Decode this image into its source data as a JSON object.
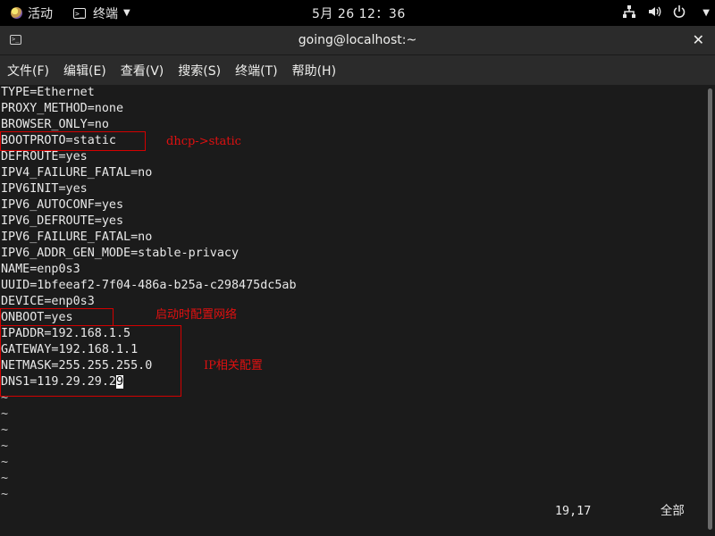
{
  "topbar": {
    "activities": "活动",
    "app_name": "终端",
    "clock": "5月 26  12：36",
    "tray_icons": [
      "network-icon",
      "volume-icon",
      "power-icon"
    ]
  },
  "window": {
    "title": "going@localhost:~",
    "menu": [
      "文件(F)",
      "编辑(E)",
      "查看(V)",
      "搜索(S)",
      "终端(T)",
      "帮助(H)"
    ]
  },
  "editor": {
    "lines": [
      "TYPE=Ethernet",
      "PROXY_METHOD=none",
      "BROWSER_ONLY=no",
      "BOOTPROTO=static",
      "DEFROUTE=yes",
      "IPV4_FAILURE_FATAL=no",
      "IPV6INIT=yes",
      "IPV6_AUTOCONF=yes",
      "IPV6_DEFROUTE=yes",
      "IPV6_FAILURE_FATAL=no",
      "IPV6_ADDR_GEN_MODE=stable-privacy",
      "NAME=enp0s3",
      "UUID=1bfeeaf2-7f04-486a-b25a-c298475dc5ab",
      "DEVICE=enp0s3",
      "ONBOOT=yes",
      "IPADDR=192.168.1.5",
      "GATEWAY=192.168.1.1",
      "NETMASK=255.255.255.0",
      "DNS1=119.29.29.2"
    ],
    "cursor_char": "9",
    "tilde_lines": [
      "~",
      "~",
      "~",
      "~",
      "~",
      "~",
      "~"
    ],
    "position": "19,17",
    "mode": "全部"
  },
  "annotations": {
    "bootproto_note": "dhcp->static",
    "onboot_note": "启动时配置网络",
    "ip_note": "IP相关配置"
  },
  "colors": {
    "annotation": "#d40000",
    "terminal_bg": "#1b1b1b",
    "terminal_fg": "#e8e8e8"
  }
}
